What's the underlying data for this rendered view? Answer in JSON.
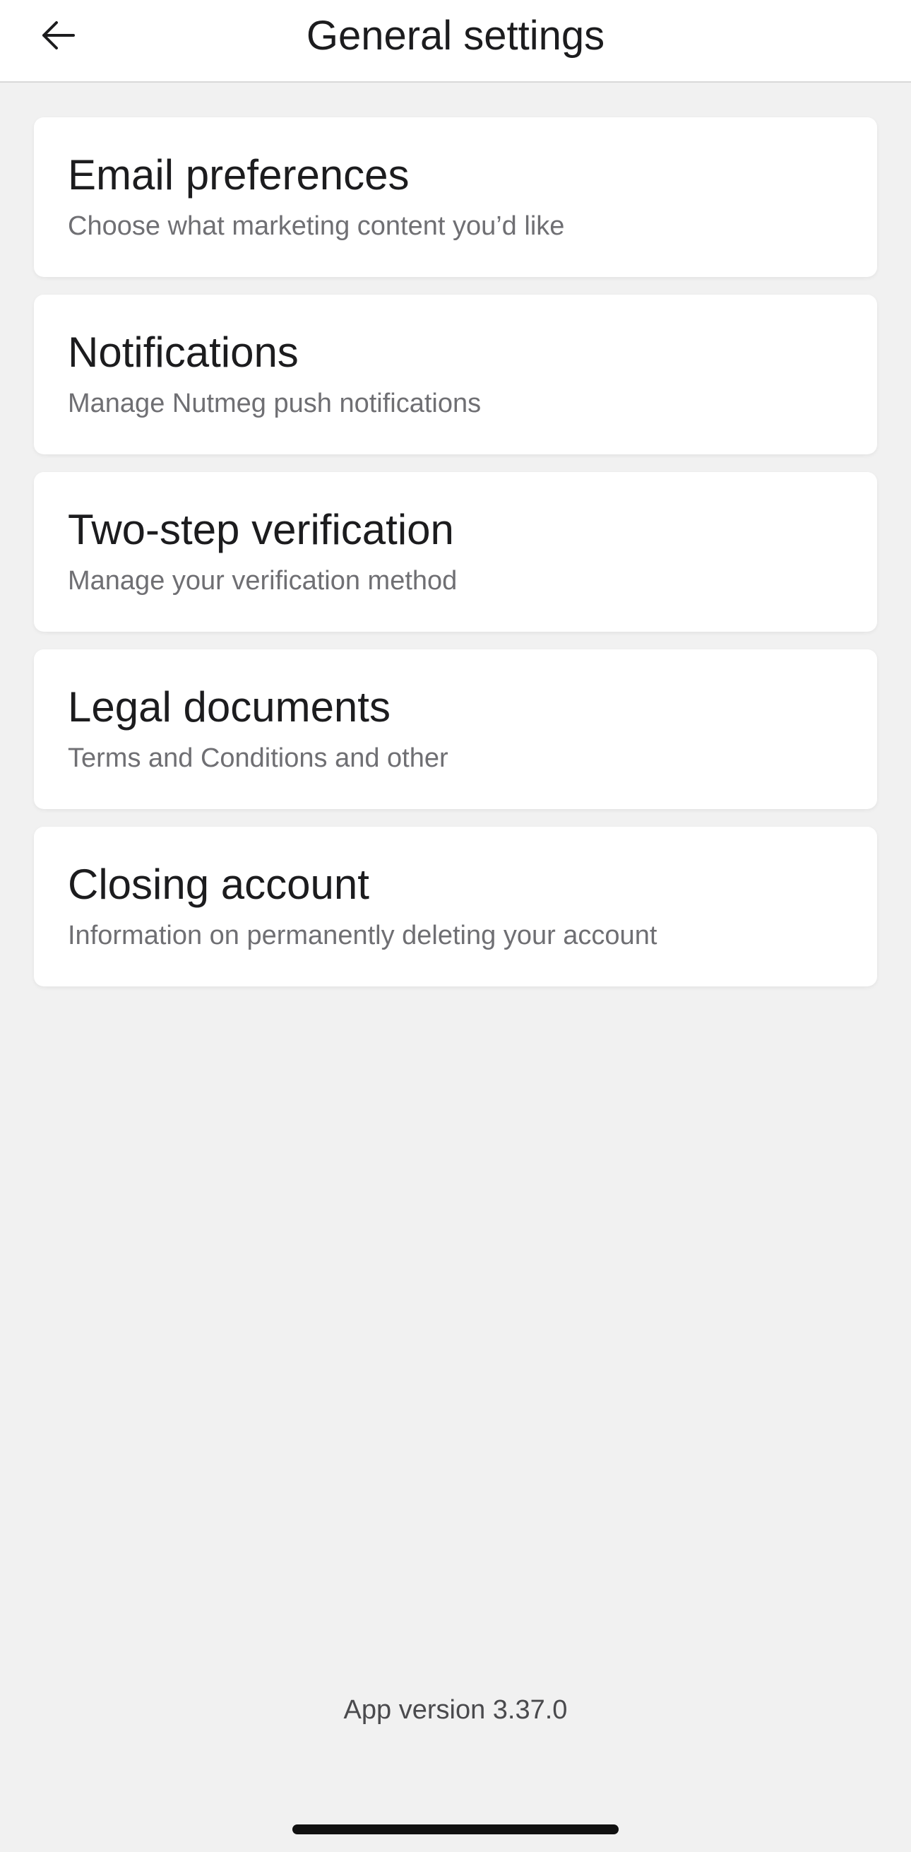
{
  "header": {
    "title": "General settings",
    "back_icon": "arrow-left-icon"
  },
  "settings": [
    {
      "title": "Email preferences",
      "subtitle": "Choose what marketing content you’d like"
    },
    {
      "title": "Notifications",
      "subtitle": "Manage Nutmeg push notifications"
    },
    {
      "title": "Two-step verification",
      "subtitle": "Manage your verification method"
    },
    {
      "title": "Legal documents",
      "subtitle": "Terms and Conditions and other"
    },
    {
      "title": "Closing account",
      "subtitle": "Information on permanently deleting your account"
    }
  ],
  "footer": {
    "app_version": "App version 3.37.0"
  },
  "colors": {
    "background": "#f1f1f1",
    "card": "#ffffff",
    "title_text": "#1c1c1e",
    "subtitle_text": "#6f6f73"
  }
}
